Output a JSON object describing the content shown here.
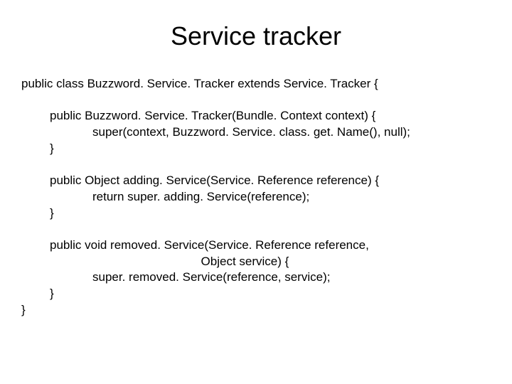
{
  "title": "Service tracker",
  "code": {
    "classDecl": "public class Buzzword. Service. Tracker extends Service. Tracker {",
    "ctor": {
      "sig": "public Buzzword. Service. Tracker(Bundle. Context context) {",
      "body": "super(context, Buzzword. Service. class. get. Name(), null);",
      "close": "}"
    },
    "adding": {
      "sig": "public Object adding. Service(Service. Reference reference) {",
      "body": "return super. adding. Service(reference);",
      "close": "}"
    },
    "removed": {
      "sig1": "public void removed. Service(Service. Reference reference,",
      "sig2": "                                             Object service) {",
      "body": "super. removed. Service(reference, service);",
      "close": "}"
    },
    "classClose": "}"
  }
}
